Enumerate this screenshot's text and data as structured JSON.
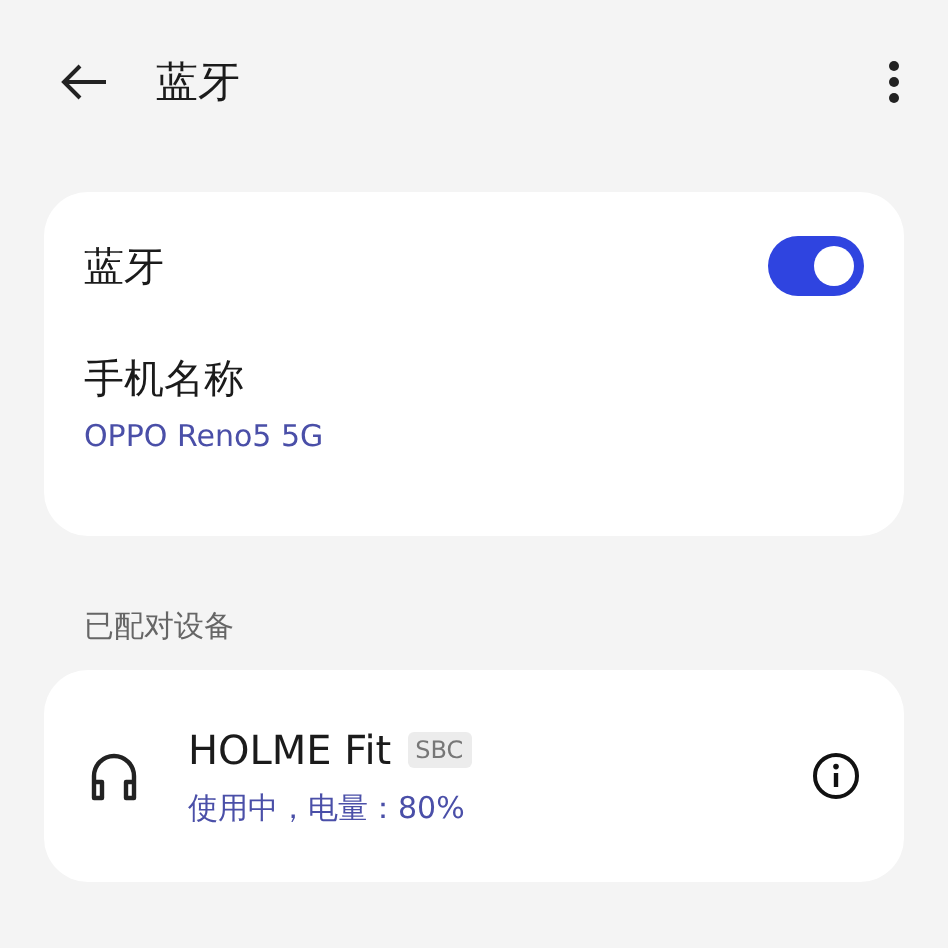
{
  "header": {
    "title": "蓝牙"
  },
  "bluetooth": {
    "label": "蓝牙",
    "on": true
  },
  "phone_name": {
    "label": "手机名称",
    "value": "OPPO Reno5 5G"
  },
  "section_title": "已配对设备",
  "devices": [
    {
      "name": "HOLME Fit",
      "codec": "SBC",
      "status": "使用中，电量：80%"
    }
  ]
}
